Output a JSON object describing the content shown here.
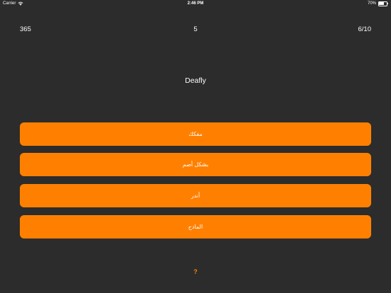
{
  "status_bar": {
    "carrier": "Carrier",
    "time": "2:46 PM",
    "battery_percent": "70%",
    "battery_level": 0.7
  },
  "stats": {
    "left": "365",
    "center": "5",
    "right": "6/10"
  },
  "question": {
    "word": "Deafly"
  },
  "options": [
    {
      "label": "مفكك"
    },
    {
      "label": "بشكل أصم"
    },
    {
      "label": "أندر"
    },
    {
      "label": "المادح"
    }
  ],
  "help": {
    "label": "?"
  },
  "colors": {
    "background": "#2c2c2c",
    "accent": "#ff8000",
    "text": "#ffffff"
  },
  "icons": {
    "wifi": "wifi-icon",
    "battery": "battery-icon"
  }
}
